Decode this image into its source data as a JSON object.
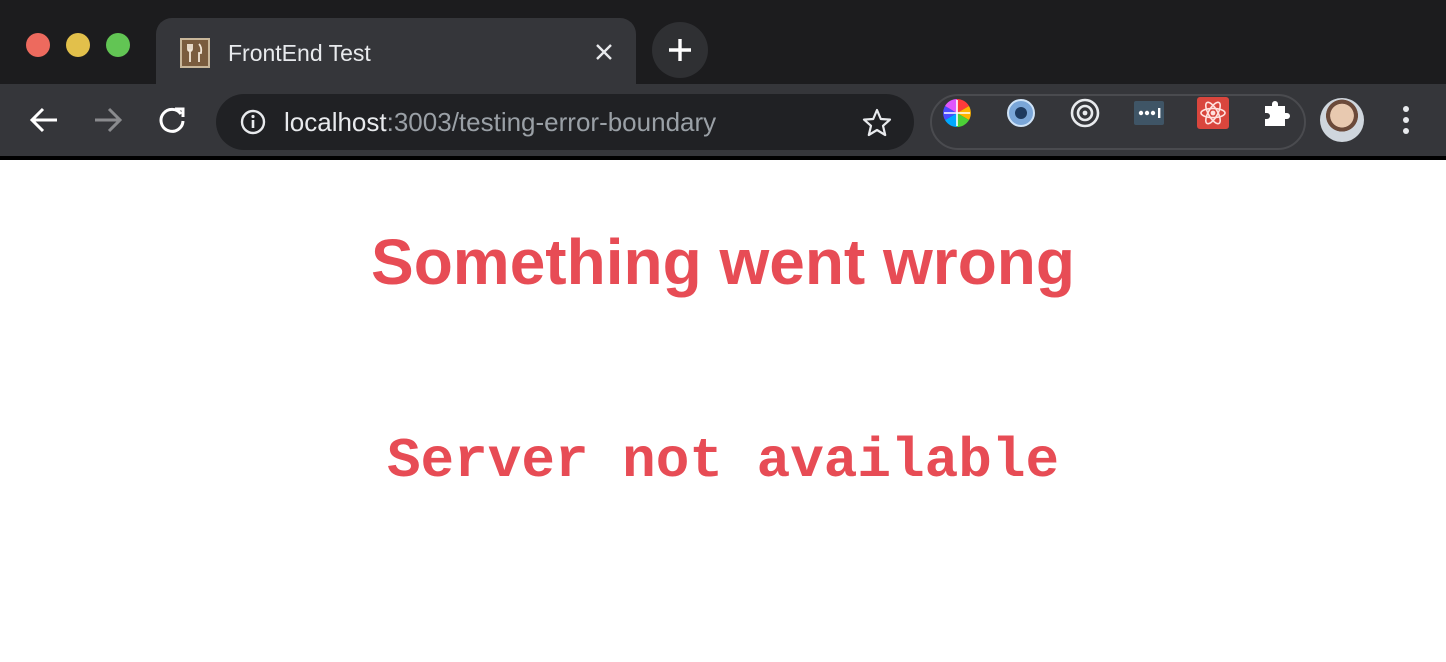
{
  "browser": {
    "tab": {
      "title": "FrontEnd Test",
      "favicon": "utensils-icon"
    },
    "address_bar": {
      "host": "localhost",
      "rest": ":3003/testing-error-boundary"
    },
    "extensions": [
      "color-wheel-extension-icon",
      "ring-extension-icon",
      "target-extension-icon",
      "dots-extension-icon",
      "react-devtools-icon",
      "puzzle-extensions-icon"
    ]
  },
  "page": {
    "error_title": "Something went wrong",
    "error_message": "Server not available",
    "error_color": "#e74c55"
  }
}
